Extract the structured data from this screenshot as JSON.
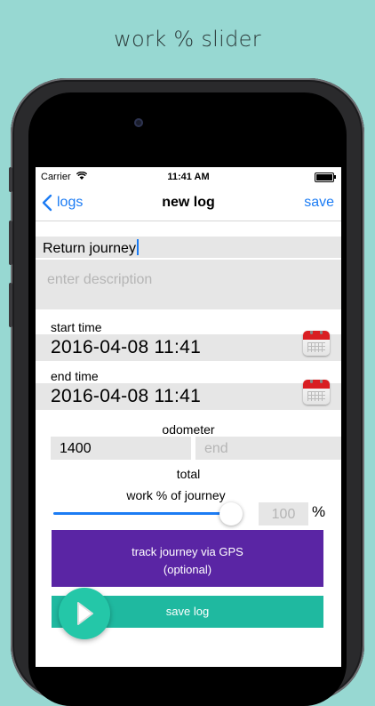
{
  "headline": "work % slider",
  "status": {
    "carrier": "Carrier",
    "time": "11:41 AM"
  },
  "nav": {
    "back_label": "logs",
    "title": "new log",
    "save_label": "save",
    "accent": "#1c7cf4"
  },
  "form": {
    "title_value": "Return journey",
    "description_placeholder": "enter description",
    "start_time_label": "start time",
    "start_time_value": "2016-04-08 11:41",
    "end_time_label": "end time",
    "end_time_value": "2016-04-08 11:41",
    "odometer_label": "odometer",
    "odometer_start_value": "1400",
    "odometer_end_placeholder": "end",
    "total_label": "total",
    "work_label": "work % of journey",
    "work_percent_value": 100,
    "work_percent_placeholder": "100",
    "percent_sign": "%"
  },
  "buttons": {
    "gps_line1": "track journey via GPS",
    "gps_line2": "(optional)",
    "gps_color": "#5a25a4",
    "save_log_label": "save log",
    "save_color": "#1fb9a0"
  },
  "icons": [
    "wifi-icon",
    "battery-icon",
    "chevron-left-icon",
    "calendar-icon",
    "play-icon"
  ]
}
